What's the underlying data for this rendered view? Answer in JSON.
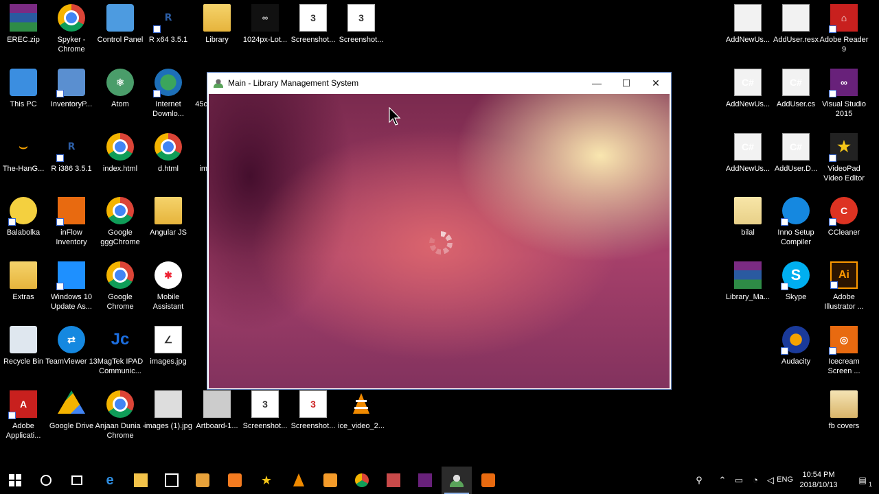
{
  "desktop": {
    "icons": [
      {
        "label": "EREC.zip"
      },
      {
        "label": "Spyker - Chrome"
      },
      {
        "label": "Control Panel"
      },
      {
        "label": "R x64 3.5.1"
      },
      {
        "label": "Library"
      },
      {
        "label": "1024px-Lot..."
      },
      {
        "label": "Screenshot..."
      },
      {
        "label": "Screenshot..."
      },
      {
        "label": "This PC"
      },
      {
        "label": "InventoryP..."
      },
      {
        "label": "Atom"
      },
      {
        "label": "Internet Downlo..."
      },
      {
        "label": "45c"
      },
      {
        "label": "The-HanG..."
      },
      {
        "label": "R i386 3.5.1"
      },
      {
        "label": "index.html"
      },
      {
        "label": "d.html"
      },
      {
        "label": "im"
      },
      {
        "label": "Balabolka"
      },
      {
        "label": "inFlow Inventory"
      },
      {
        "label": "Google gggChrome"
      },
      {
        "label": "Angular JS"
      },
      {
        "label": "Extras"
      },
      {
        "label": "Windows 10 Update As..."
      },
      {
        "label": "Google Chrome"
      },
      {
        "label": "Mobile Assistant"
      },
      {
        "label": "Recycle Bin"
      },
      {
        "label": "TeamViewer 13"
      },
      {
        "label": "MagTek IPAD Communic..."
      },
      {
        "label": "images.jpg"
      },
      {
        "label": "Adobe Applicati..."
      },
      {
        "label": "Google Drive"
      },
      {
        "label": "Anjaan Dunia - Chrome"
      },
      {
        "label": "images (1).jpg"
      },
      {
        "label": "Artboard-1..."
      },
      {
        "label": "Screenshot..."
      },
      {
        "label": "Screenshot..."
      },
      {
        "label": "ice_video_2..."
      },
      {
        "label": "AddNewUs..."
      },
      {
        "label": "AddUser.resx"
      },
      {
        "label": "Adobe Reader 9"
      },
      {
        "label": "AddNewUs..."
      },
      {
        "label": "AddUser.cs"
      },
      {
        "label": "Visual Studio 2015"
      },
      {
        "label": "AddNewUs..."
      },
      {
        "label": "AddUser.D..."
      },
      {
        "label": "VideoPad Video Editor"
      },
      {
        "label": "bilal"
      },
      {
        "label": "Inno Setup Compiler"
      },
      {
        "label": "CCleaner"
      },
      {
        "label": "Library_Ma..."
      },
      {
        "label": "Skype"
      },
      {
        "label": "Adobe Illustrator ..."
      },
      {
        "label": "Audacity"
      },
      {
        "label": "Icecream Screen ..."
      },
      {
        "label": "fb covers"
      }
    ]
  },
  "window": {
    "title": "Main - Library Management System",
    "min_glyph": "—",
    "max_glyph": "☐",
    "close_glyph": "✕"
  },
  "taskbar": {
    "lang": "ENG",
    "time": "10:54 PM",
    "date": "2018/10/13",
    "notifications": "1"
  },
  "colors": {
    "window_border": "#6a8cc7",
    "desktop_bg": "#000000"
  }
}
